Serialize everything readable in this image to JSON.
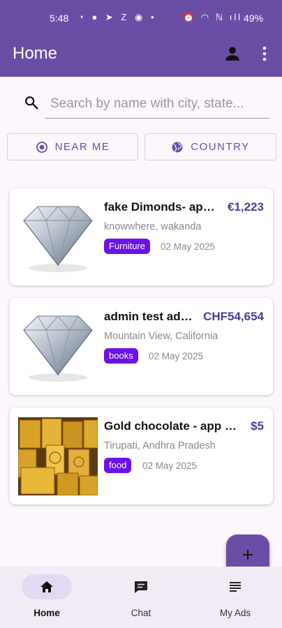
{
  "status_bar": {
    "time": "5:48",
    "left_icons": "◔ ● ➤ Z ◉ •",
    "right_icons": "⏰ ◠ ℕ ıll",
    "battery": "49%"
  },
  "app_bar": {
    "title": "Home",
    "profile_icon": "person-icon",
    "menu_icon": "more-vert-icon"
  },
  "search": {
    "placeholder": "Search by name with city, state...",
    "value": ""
  },
  "filters": [
    {
      "label": "NEAR ME",
      "icon": "my-location-icon"
    },
    {
      "label": "COUNTRY",
      "icon": "globe-icon"
    }
  ],
  "listings": [
    {
      "name": "fake Dimonds- app…",
      "price": "€1,223",
      "location": "knowwhere, wakanda",
      "category": "Furniture",
      "date": "02 May 2025",
      "image": "diamond-image"
    },
    {
      "name": "admin test ad …",
      "price": "CHF54,654",
      "location": "Mountain View, California",
      "category": "books",
      "date": "02 May 2025",
      "image": "diamond-image"
    },
    {
      "name": "Gold chocolate  - app …",
      "price": "$5",
      "location": "Tirupati, Andhra Pradesh",
      "category": "food",
      "date": "02 May 2025",
      "image": "gold-bars-image"
    }
  ],
  "fab": {
    "icon": "plus-icon"
  },
  "bottom_nav": [
    {
      "label": "Home",
      "icon": "home-icon",
      "active": true
    },
    {
      "label": "Chat",
      "icon": "chat-icon",
      "active": false
    },
    {
      "label": "My Ads",
      "icon": "list-icon",
      "active": false
    }
  ],
  "colors": {
    "primary": "#6a4ea6",
    "tag": "#6a12e8",
    "price": "#4f3a96",
    "background": "#fcf6fd"
  }
}
